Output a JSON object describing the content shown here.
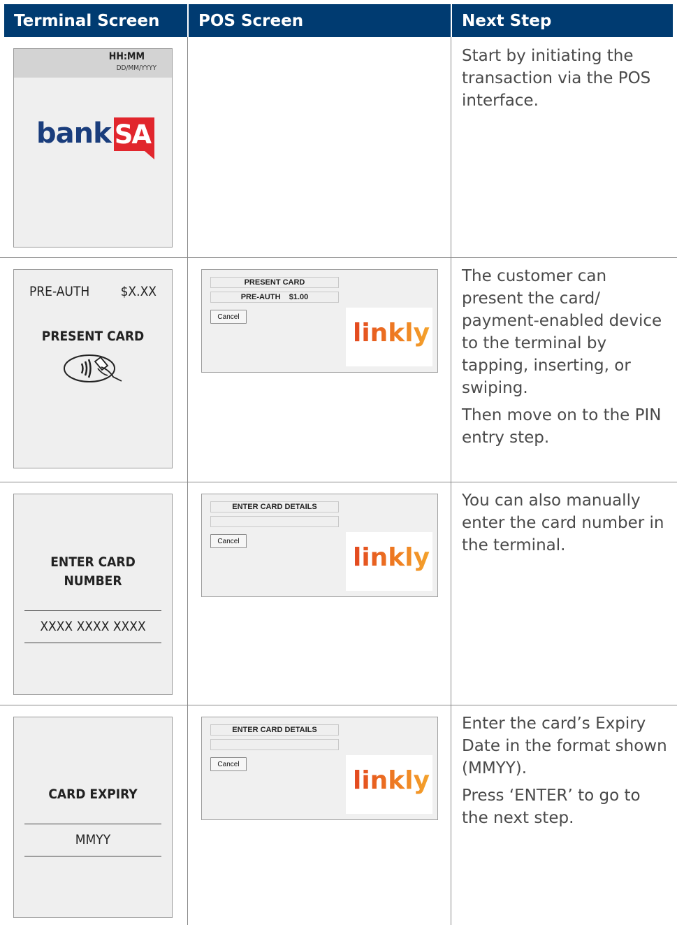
{
  "headers": {
    "terminal_screen": "Terminal Screen",
    "pos_screen": "POS Screen",
    "next_step": "Next Step"
  },
  "colors": {
    "header_bg": "#003b71",
    "bank_blue": "#1a3d7c",
    "bank_red": "#e1262d",
    "linkly_orange": "#ef7f22"
  },
  "rows": [
    {
      "terminal": {
        "time": "HH:MM",
        "date": "DD/MM/YYYY",
        "logo_text": "bank",
        "logo_badge": "SA"
      },
      "next_step": [
        "Start by initiating the transaction via the POS interface."
      ]
    },
    {
      "terminal": {
        "pre_auth_label": "PRE-AUTH",
        "amount": "$X.XX",
        "prompt": "PRESENT CARD",
        "icon": "contactless-card-icon"
      },
      "pos": {
        "line1": "PRESENT CARD",
        "line2": "PRE-AUTH    $1.00",
        "cancel": "Cancel",
        "logo": "linkly"
      },
      "next_step": [
        "The customer can present the card/ payment-enabled device to the terminal by tapping, inserting, or swiping.",
        "Then move on to the PIN entry step."
      ]
    },
    {
      "terminal": {
        "prompt_line1": "ENTER CARD",
        "prompt_line2": "NUMBER",
        "value": "XXXX XXXX XXXX"
      },
      "pos": {
        "line1": "ENTER CARD DETAILS",
        "line2": "",
        "cancel": "Cancel",
        "logo": "linkly"
      },
      "next_step": [
        "You can also manually enter the card number in the terminal."
      ]
    },
    {
      "terminal": {
        "prompt": "CARD EXPIRY",
        "value": "MMYY"
      },
      "pos": {
        "line1": "ENTER CARD DETAILS",
        "line2": "",
        "cancel": "Cancel",
        "logo": "linkly"
      },
      "next_step": [
        "Enter the card’s Expiry Date in the format shown (MMYY).",
        "Press ‘ENTER’ to go to the next step."
      ]
    }
  ]
}
